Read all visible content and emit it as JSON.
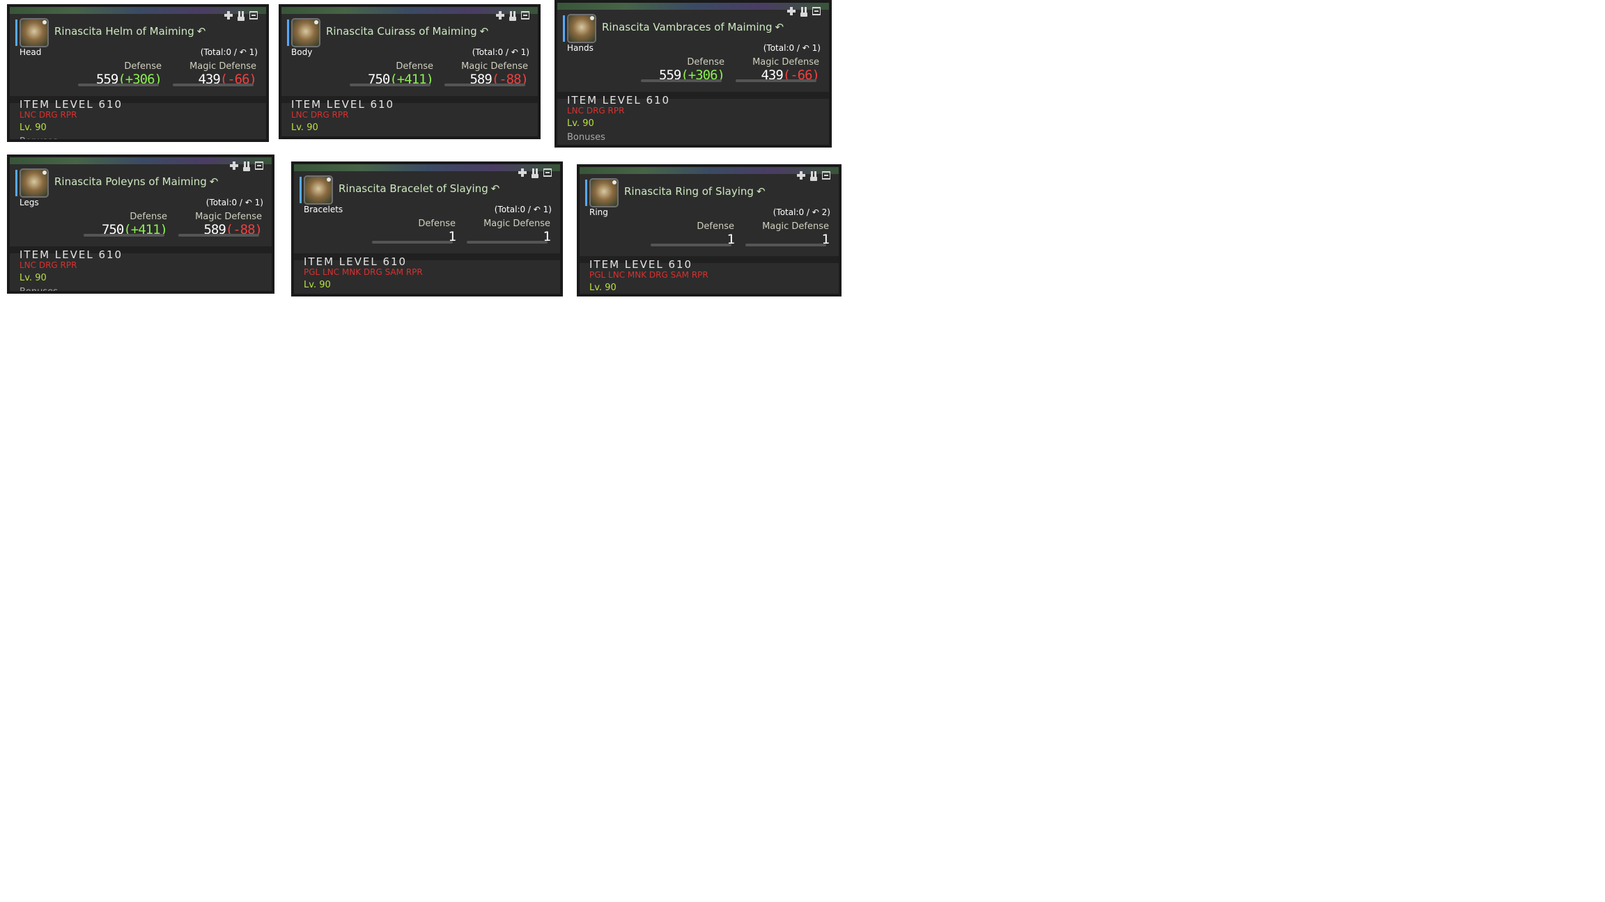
{
  "labels": {
    "defense": "Defense",
    "magic_defense": "Magic Defense",
    "bonuses": "Bonuses"
  },
  "items": [
    {
      "name": "Rinascita Helm of Maiming",
      "slot": "Head",
      "total": "(Total:0 /",
      "slots_count": "1)",
      "defense": "559",
      "defense_delta": "(+306)",
      "magic_defense": "439",
      "magic_defense_delta": "(-66)",
      "item_level": "ITEM LEVEL 610",
      "jobs": "LNC DRG RPR",
      "level": "Lv. 90"
    },
    {
      "name": "Rinascita Cuirass of Maiming",
      "slot": "Body",
      "total": "(Total:0 /",
      "slots_count": "1)",
      "defense": "750",
      "defense_delta": "(+411)",
      "magic_defense": "589",
      "magic_defense_delta": "(-88)",
      "item_level": "ITEM LEVEL 610",
      "jobs": "LNC DRG RPR",
      "level": "Lv. 90"
    },
    {
      "name": "Rinascita Vambraces of Maiming",
      "slot": "Hands",
      "total": "(Total:0 /",
      "slots_count": "1)",
      "defense": "559",
      "defense_delta": "(+306)",
      "magic_defense": "439",
      "magic_defense_delta": "(-66)",
      "item_level": "ITEM LEVEL 610",
      "jobs": "LNC DRG RPR",
      "level": "Lv. 90"
    },
    {
      "name": "Rinascita Poleyns of Maiming",
      "slot": "Legs",
      "total": "(Total:0 /",
      "slots_count": "1)",
      "defense": "750",
      "defense_delta": "(+411)",
      "magic_defense": "589",
      "magic_defense_delta": "(-88)",
      "item_level": "ITEM LEVEL 610",
      "jobs": "LNC DRG RPR",
      "level": "Lv. 90"
    },
    {
      "name": "Rinascita Bracelet of Slaying",
      "slot": "Bracelets",
      "total": "(Total:0 /",
      "slots_count": "1)",
      "defense": "1",
      "defense_delta": "",
      "magic_defense": "1",
      "magic_defense_delta": "",
      "item_level": "ITEM LEVEL 610",
      "jobs": "PGL LNC MNK DRG SAM RPR",
      "level": "Lv. 90"
    },
    {
      "name": "Rinascita Ring of Slaying",
      "slot": "Ring",
      "total": "(Total:0 /",
      "slots_count": "2)",
      "defense": "1",
      "defense_delta": "",
      "magic_defense": "1",
      "magic_defense_delta": "",
      "item_level": "ITEM LEVEL 610",
      "jobs": "PGL LNC MNK DRG SAM RPR",
      "level": "Lv. 90"
    }
  ]
}
